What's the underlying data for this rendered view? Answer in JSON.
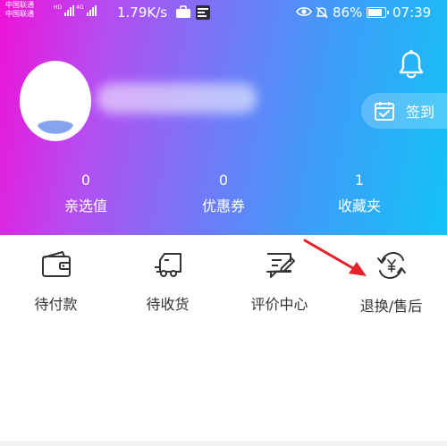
{
  "status_bar": {
    "carrier_line1": "中国联通",
    "carrier_line2": "中国联通",
    "net_label_1": "HD",
    "net_label_2": "4G",
    "speed": "1.79K/s",
    "battery_percent": "86%",
    "battery_level": 0.86,
    "time": "07:39",
    "icons": [
      "signal-icon",
      "briefcase-icon",
      "app-badge-icon",
      "eye-icon",
      "bell-off-icon",
      "battery-icon"
    ]
  },
  "header": {
    "gradient_colors": [
      "#ee12d6",
      "#7a74f7",
      "#13c3f7"
    ],
    "signin_label": "签到",
    "icons": [
      "bell-icon",
      "calendar-check-icon",
      "avatar-icon"
    ]
  },
  "stats": [
    {
      "value": "0",
      "label": "亲选值"
    },
    {
      "value": "0",
      "label": "优惠券"
    },
    {
      "value": "1",
      "label": "收藏夹"
    }
  ],
  "orders": [
    {
      "label": "待付款",
      "icon": "wallet-icon"
    },
    {
      "label": "待收货",
      "icon": "delivery-truck-icon"
    },
    {
      "label": "评价中心",
      "icon": "review-edit-icon"
    },
    {
      "label": "退换/售后",
      "icon": "refund-exchange-icon"
    }
  ],
  "annotation": {
    "icon": "red-arrow-icon",
    "color": "#e8202a"
  }
}
